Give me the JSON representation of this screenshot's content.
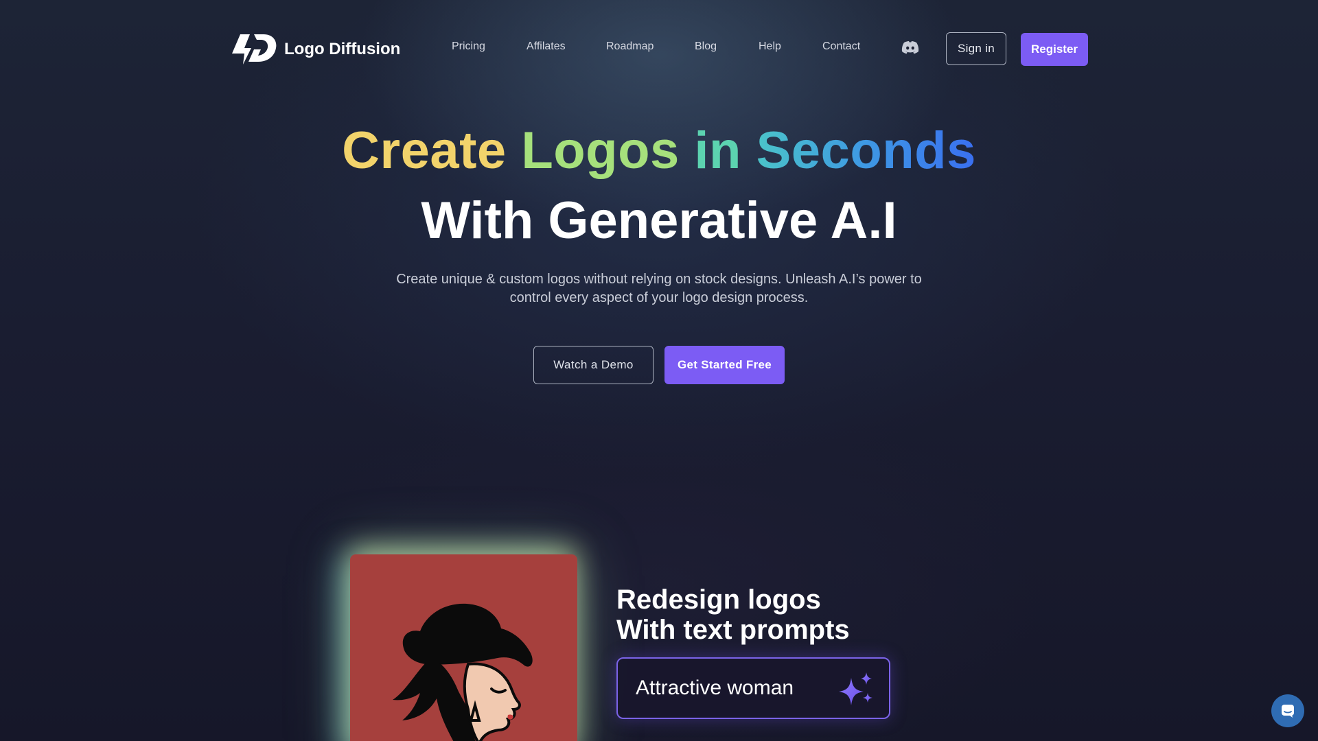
{
  "nav": {
    "brand_name": "Logo Diffusion",
    "links": [
      "Pricing",
      "Affilates",
      "Roadmap",
      "Blog",
      "Help",
      "Contact"
    ],
    "discord_icon": "discord-icon",
    "sign_in_label": "Sign in",
    "register_label": "Register"
  },
  "hero": {
    "title_words": [
      "Create",
      "Logos",
      "in",
      "Seconds"
    ],
    "title_line2": "With Generative A.I",
    "subtitle": "Create unique & custom logos without relying on stock designs. Unleash A.I’s power to control every aspect of your logo design process.",
    "demo_label": "Watch a Demo",
    "start_label": "Get Started Free"
  },
  "feature": {
    "title_line1": "Redesign logos",
    "title_line2": "With text prompts",
    "prompt_text": "Attractive woman",
    "prompt_icon": "sparkle-icon",
    "card_color": "#a6403d"
  },
  "chat": {
    "icon": "chat-icon"
  },
  "colors": {
    "accent": "#7c5cf4",
    "background": "#171a2c",
    "gradient": [
      "#f2d36b",
      "#a6e07c",
      "#5cd3b0",
      "#3a6ff0"
    ]
  }
}
